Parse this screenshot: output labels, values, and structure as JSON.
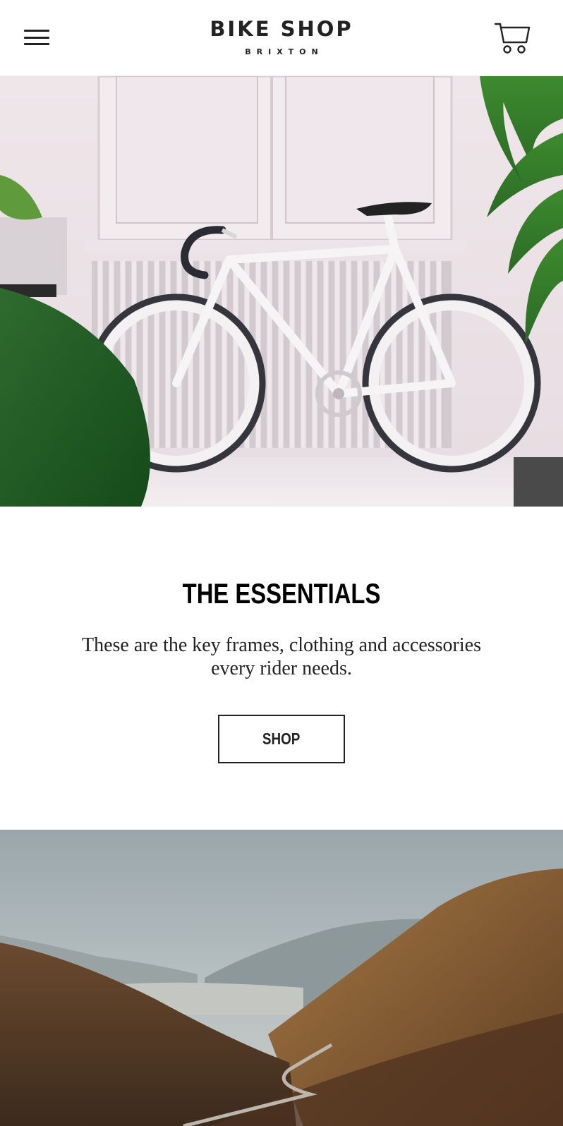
{
  "header": {
    "logo_title": "BIKE SHOP",
    "logo_subtitle": "BRIXTON",
    "menu_icon": "hamburger-menu-icon",
    "cart_icon": "shopping-cart-icon"
  },
  "hero": {
    "image_subject": "white fixed-gear bicycle in front of radiator with plants"
  },
  "essentials": {
    "title": "THE ESSENTIALS",
    "description": "These are the key frames, clothing and accessories every rider needs.",
    "shop_label": "SHOP"
  },
  "landscape": {
    "image_subject": "mountain valley with winding road"
  },
  "colors": {
    "text": "#222222",
    "background": "#ffffff",
    "title": "#000000"
  }
}
